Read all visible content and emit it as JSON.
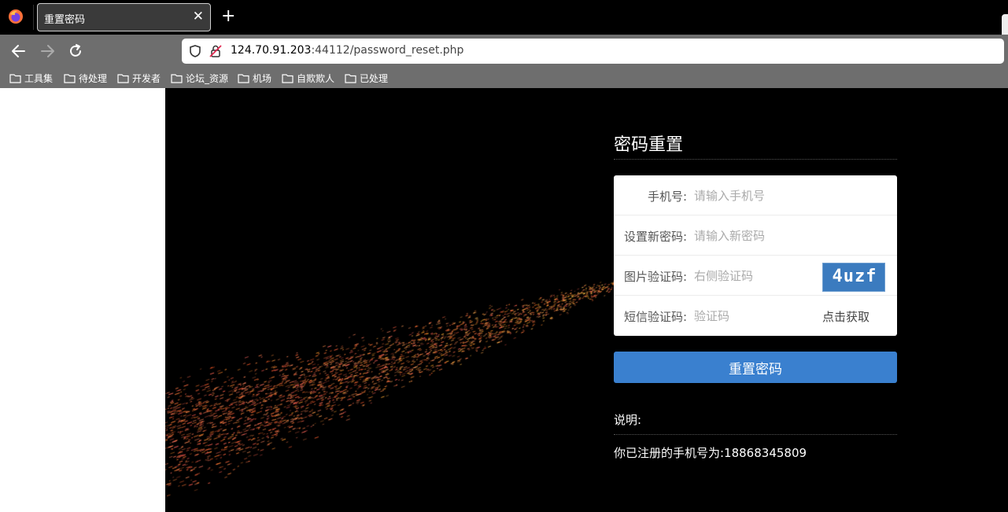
{
  "browser": {
    "tab_title": "重置密码",
    "tab_close": "✕",
    "new_tab": "+",
    "url_host": "124.70.91.203",
    "url_rest": ":44112/password_reset.php",
    "bookmarks": [
      "工具集",
      "待处理",
      "开发者",
      "论坛_资源",
      "机场",
      "自欺欺人",
      "已处理"
    ]
  },
  "form": {
    "title": "密码重置",
    "phone_label": "手机号:",
    "phone_placeholder": "请输入手机号",
    "new_password_label": "设置新密码:",
    "new_password_placeholder": "请输入新密码",
    "captcha_label": "图片验证码:",
    "captcha_placeholder": "右侧验证码",
    "captcha_text": "4uzf",
    "sms_label": "短信验证码:",
    "sms_placeholder": "验证码",
    "sms_button": "点击获取",
    "submit_label": "重置密码"
  },
  "note": {
    "title": "说明:",
    "text": "你已注册的手机号为:18868345809"
  },
  "colors": {
    "button": "#3a80cf",
    "captcha_bg": "#3b7bbf",
    "chrome": "#6e6e6e"
  }
}
